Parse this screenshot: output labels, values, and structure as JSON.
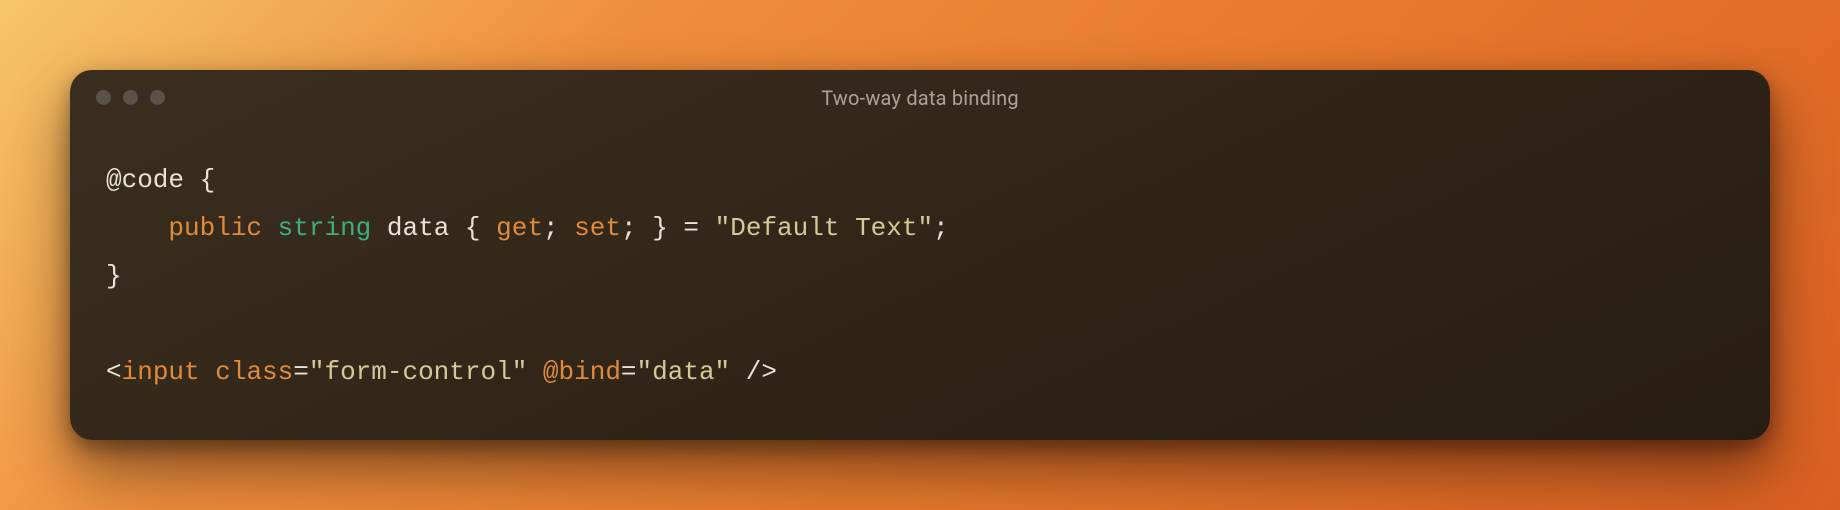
{
  "window": {
    "title": "Two-way data binding"
  },
  "code": {
    "line1": {
      "at_code": "@code",
      "brace_open": " {"
    },
    "line2": {
      "indent": "    ",
      "kw_public": "public",
      "sp1": " ",
      "type_string": "string",
      "sp2": " ",
      "ident_data": "data",
      "sp3": " ",
      "accessor_open": "{ ",
      "kw_get": "get",
      "semi1": ";",
      "sp4": " ",
      "kw_set": "set",
      "semi2": ";",
      "accessor_close": " }",
      "sp5": " ",
      "eq": "=",
      "sp6": " ",
      "str_default": "\"Default Text\"",
      "semi3": ";"
    },
    "line3": {
      "brace_close": "}"
    },
    "line5": {
      "lt": "<",
      "tag_input": "input",
      "sp1": " ",
      "attr_class": "class",
      "eq1": "=",
      "val_class": "\"form-control\"",
      "sp2": " ",
      "attr_bind": "@bind",
      "eq2": "=",
      "val_bind": "\"data\"",
      "sp3": " ",
      "selfclose": "/>"
    }
  }
}
